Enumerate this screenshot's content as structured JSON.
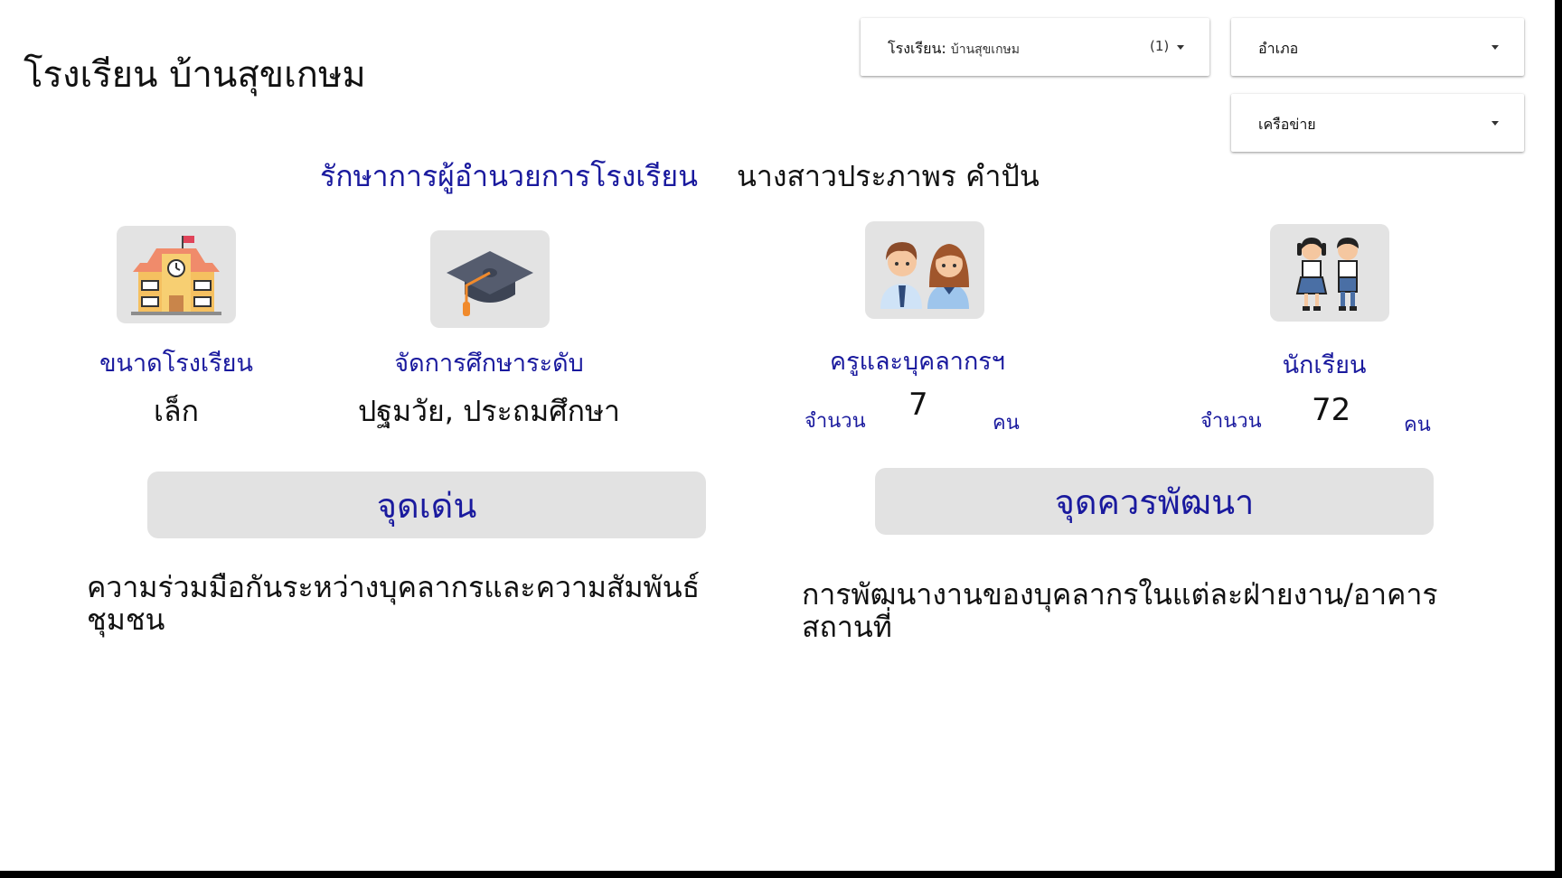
{
  "page_title": "โรงเรียน บ้านสุขเกษม",
  "filters": {
    "school": {
      "label": "โรงเรียน",
      "value": "บ้านสุขเกษม",
      "count": "(1)"
    },
    "district": {
      "label": "อำเภอ"
    },
    "network": {
      "label": "เครือข่าย"
    }
  },
  "director": {
    "label": "รักษาการผู้อำนวยการโรงเรียน",
    "name": "นางสาวประภาพร คำปัน"
  },
  "stats": {
    "school_size": {
      "label": "ขนาดโรงเรียน",
      "value": "เล็ก",
      "icon": "school-building-icon"
    },
    "education_level": {
      "label": "จัดการศึกษาระดับ",
      "value": "ปฐมวัย, ประถมศึกษา",
      "icon": "graduation-cap-icon"
    },
    "staff": {
      "label": "ครูและบุคลากรฯ",
      "amount_label": "จำนวน",
      "value": "7",
      "unit": "คน",
      "icon": "teachers-icon"
    },
    "students": {
      "label": "นักเรียน",
      "amount_label": "จำนวน",
      "value": "72",
      "unit": "คน",
      "icon": "students-icon"
    }
  },
  "strengths": {
    "title": "จุดเด่น",
    "text": "ความร่วมมือกันระหว่างบุคลากรและความสัมพันธ์ชุมชน"
  },
  "improvements": {
    "title": "จุดควรพัฒนา",
    "text": "การพัฒนางานของบุคลากรในแต่ละฝ่ายงาน/อาคารสถานที่"
  },
  "colors": {
    "accent_text": "#1a1a9e",
    "card_bg": "#e2e2e2",
    "icon_bg": "#e3e3e3"
  }
}
